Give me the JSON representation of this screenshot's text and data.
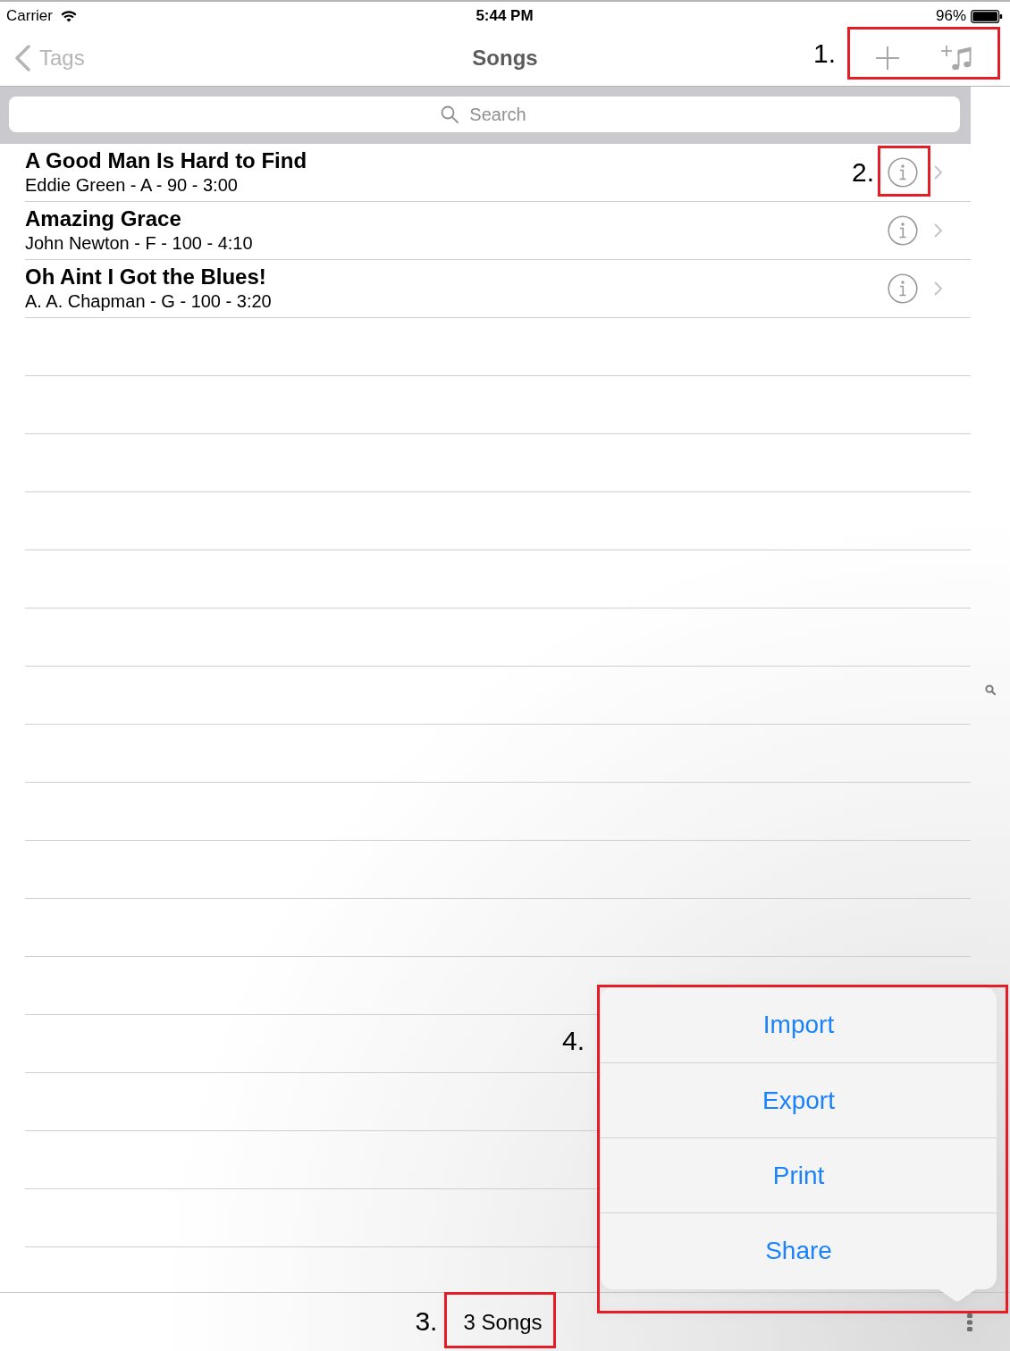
{
  "status_bar": {
    "carrier": "Carrier",
    "time": "5:44 PM",
    "battery": "96%"
  },
  "nav_bar": {
    "back": "Tags",
    "title": "Songs",
    "actions_callout": "1."
  },
  "search_bar": {
    "placeholder": "Search"
  },
  "songs": [
    {
      "title": "A Good Man Is Hard to Find",
      "details": "Eddie Green - A - 90 - 3:00",
      "callout": "2."
    },
    {
      "title": "Amazing Grace",
      "details": "John Newton - F - 100 - 4:10"
    },
    {
      "title": "Oh Aint I Got the Blues!",
      "details": "A. A. Chapman - G - 100 - 3:20"
    }
  ],
  "toolbar": {
    "count": "3 Songs",
    "count_callout": "3."
  },
  "popover_menu": {
    "items": [
      "Import",
      "Export",
      "Print",
      "Share"
    ],
    "callout": "4."
  }
}
